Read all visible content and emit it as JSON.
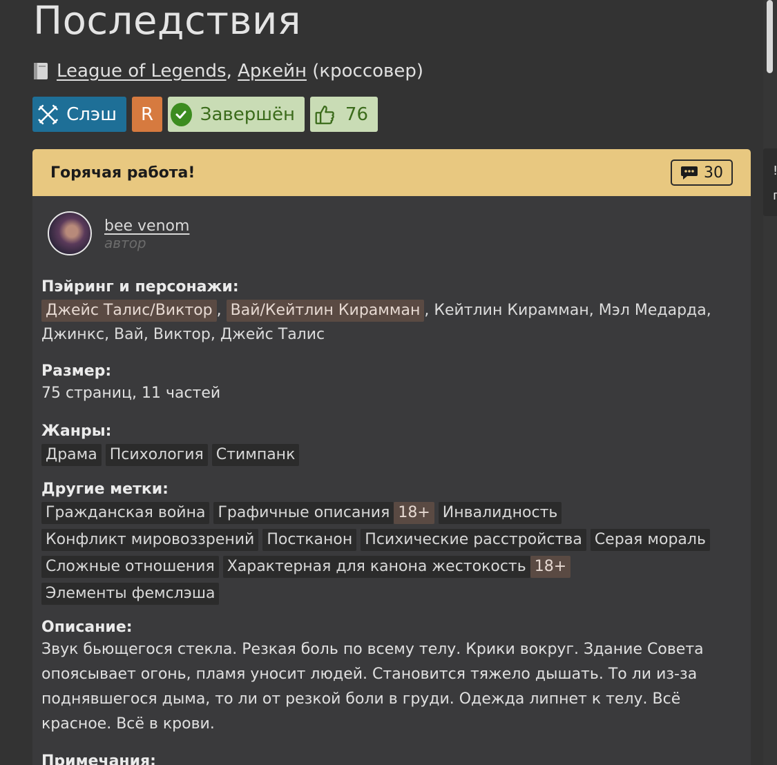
{
  "title": "Последствия",
  "fandoms": {
    "icon": "book-icon",
    "items": [
      "League of Legends",
      "Аркейн"
    ],
    "separator": ",",
    "suffix": "(кроссовер)"
  },
  "badges": {
    "direction": "Слэш",
    "rating": "R",
    "status": "Завершён",
    "likes": "76"
  },
  "card": {
    "header": "Горячая работа!",
    "comments_count": "30",
    "author": {
      "name": "bee venom",
      "role": "автор"
    },
    "pairing": {
      "label": "Пэйринг и персонажи:",
      "pairs": [
        "Джейс Талис/Виктор",
        "Вай/Кейтлин Кирамман"
      ],
      "characters_line1": ", Кейтлин Кирамман, Мэл Медарда,",
      "characters_line2": "Джинкс, Вай, Виктор, Джейс Талис",
      "comma": ","
    },
    "size": {
      "label": "Размер:",
      "value": "75 страниц, 11 частей"
    },
    "genres": {
      "label": "Жанры:",
      "items": [
        "Драма",
        "Психология",
        "Стимпанк"
      ]
    },
    "other_tags": {
      "label": "Другие метки:",
      "items": [
        "Гражданская война",
        "Графичные описания",
        "18+",
        "Инвалидность",
        "Конфликт мировоззрений",
        "Постканон",
        "Психические расстройства",
        "Серая мораль",
        "Сложные отношения",
        "Характерная для канона жестокость",
        "18+",
        "Элементы фемслэша"
      ]
    },
    "description": {
      "label": "Описание:",
      "lines": [
        "Звук бьющегося стекла. Резкая боль по всему телу. Крики вокруг. Здание Совета",
        "опоясывает огонь, пламя уносит людей. Становится тяжело дышать. То ли из-за",
        "поднявшегося дыма, то ли от резкой боли в груди. Одежда липнет к телу. Всё",
        "красное. Всё в крови."
      ]
    },
    "notes": {
      "label": "Примечания:"
    }
  },
  "side_panel": {
    "chars": [
      "!",
      "г"
    ]
  },
  "colors": {
    "background": "#333333",
    "direction_badge": "#1e6f97",
    "rating_badge": "#d67a3f",
    "status_badge": "#c9dcb5",
    "card_header": "#e8c880",
    "pair_tag": "#5a4a43"
  }
}
